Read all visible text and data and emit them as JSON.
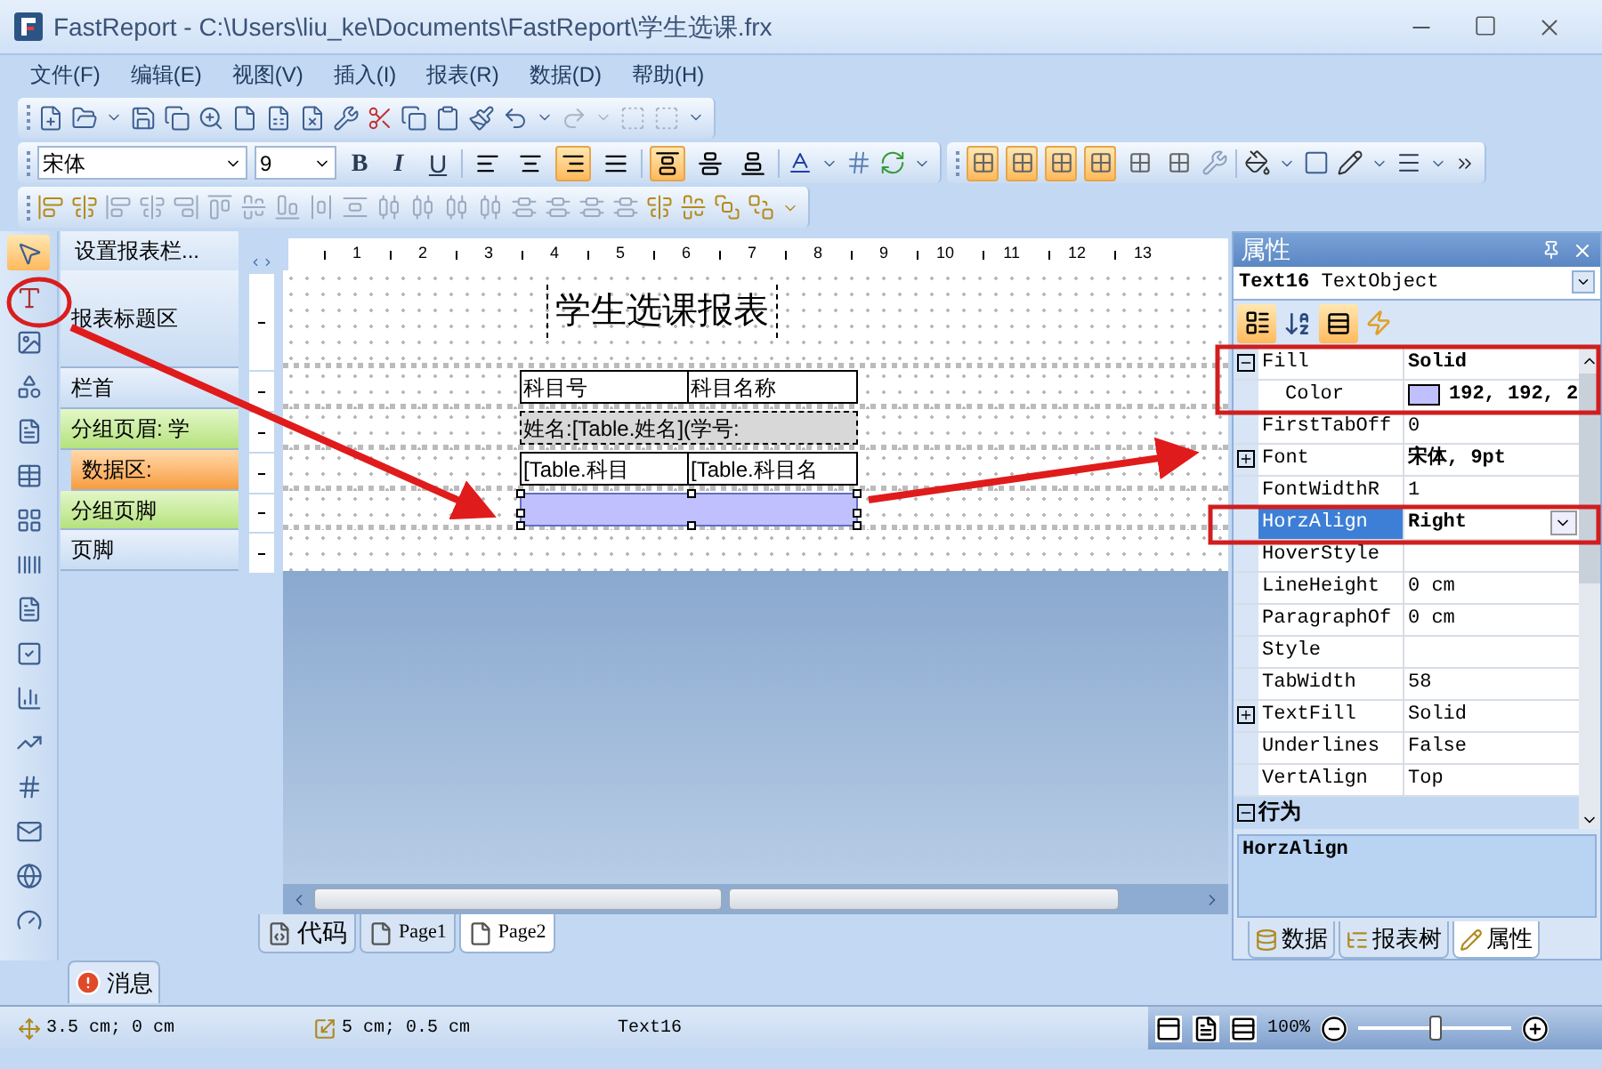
{
  "window": {
    "title": "FastReport - C:\\Users\\liu_ke\\Documents\\FastReport\\学生选课.frx"
  },
  "menu": [
    "文件(F)",
    "编辑(E)",
    "视图(V)",
    "插入(I)",
    "报表(R)",
    "数据(D)",
    "帮助(H)"
  ],
  "format_toolbar": {
    "font": "宋体",
    "size": "9",
    "styles": [
      {
        "label": "B",
        "kind": "bold"
      },
      {
        "label": "I",
        "kind": "italic"
      },
      {
        "label": "U",
        "kind": "underline"
      }
    ],
    "horz_align": [
      {
        "kind": "left",
        "selected": false
      },
      {
        "kind": "center",
        "selected": false
      },
      {
        "kind": "right",
        "selected": true
      },
      {
        "kind": "justify",
        "selected": false
      }
    ],
    "vert_align": [
      {
        "kind": "top",
        "selected": true
      },
      {
        "kind": "middle",
        "selected": false
      },
      {
        "kind": "bottom",
        "selected": false
      }
    ]
  },
  "border_toolbar": [
    {
      "selected": true
    },
    {
      "selected": true
    },
    {
      "selected": true
    },
    {
      "selected": true
    },
    {
      "selected": false
    },
    {
      "selected": false
    }
  ],
  "toolbox": [
    {
      "kind": "pointer",
      "selected": true
    },
    {
      "kind": "text",
      "selected": false
    },
    {
      "kind": "picture",
      "selected": false
    },
    {
      "kind": "shapes",
      "selected": false
    },
    {
      "kind": "subreport",
      "selected": false
    },
    {
      "kind": "table",
      "selected": false
    },
    {
      "kind": "matrix",
      "selected": false
    },
    {
      "kind": "barcode",
      "selected": false
    },
    {
      "kind": "richtext",
      "selected": false
    },
    {
      "kind": "checkbox",
      "selected": false
    },
    {
      "kind": "chart",
      "selected": false
    },
    {
      "kind": "sparkline",
      "selected": false
    },
    {
      "kind": "number",
      "selected": false
    },
    {
      "kind": "zipcode",
      "selected": false
    },
    {
      "kind": "map",
      "selected": false
    },
    {
      "kind": "gauge",
      "selected": false
    }
  ],
  "bands_header": "设置报表栏...",
  "ruler": [
    "1",
    "2",
    "3",
    "4",
    "5",
    "6",
    "7",
    "8",
    "9",
    "10",
    "11",
    "12",
    "13"
  ],
  "bands": [
    {
      "label": "报表标题区",
      "kind": "plain"
    },
    {
      "label": "栏首",
      "kind": "plain"
    },
    {
      "label": "分组页眉: 学",
      "kind": "group"
    },
    {
      "label": "数据区:",
      "kind": "data"
    },
    {
      "label": "分组页脚",
      "kind": "group"
    },
    {
      "label": "页脚",
      "kind": "plain"
    }
  ],
  "report": {
    "title": "学生选课报表",
    "header_cells": [
      "科目号",
      "科目名称"
    ],
    "group_text": "姓名:[Table.姓名](学号:",
    "data_cells": [
      "[Table.科目",
      "[Table.科目名"
    ]
  },
  "page_tabs": [
    {
      "label": "代码",
      "kind": "code",
      "selected": false
    },
    {
      "label": "Page1",
      "kind": "page",
      "selected": false
    },
    {
      "label": "Page2",
      "kind": "page",
      "selected": true
    }
  ],
  "message_tab": "消息",
  "properties": {
    "title": "属性",
    "object": "Text16",
    "object_type": "TextObject",
    "rows": [
      {
        "name": "Fill",
        "value": "Solid",
        "expanded": true,
        "modified": true,
        "selected": false
      },
      {
        "name": "Color",
        "value": "192, 192, 2",
        "color": "#c0c0ff",
        "child": true,
        "modified": true,
        "selected": false
      },
      {
        "name": "FirstTabOff",
        "value": "0",
        "modified": false,
        "selected": false
      },
      {
        "name": "Font",
        "value": "宋体, 9pt",
        "expanded": false,
        "modified": true,
        "selected": false
      },
      {
        "name": "FontWidthR",
        "value": "1",
        "modified": false,
        "selected": false
      },
      {
        "name": "HorzAlign",
        "value": "Right",
        "modified": true,
        "selected": true
      },
      {
        "name": "HoverStyle",
        "modified": false,
        "selected": false
      },
      {
        "name": "LineHeight",
        "value": "0 cm",
        "modified": false,
        "selected": false
      },
      {
        "name": "ParagraphOf",
        "value": "0 cm",
        "modified": false,
        "selected": false
      },
      {
        "name": "Style",
        "modified": false,
        "selected": false
      },
      {
        "name": "TabWidth",
        "value": "58",
        "modified": false,
        "selected": false
      },
      {
        "name": "TextFill",
        "value": "Solid",
        "expanded": false,
        "modified": false,
        "selected": false
      },
      {
        "name": "Underlines",
        "value": "False",
        "modified": false,
        "selected": false
      },
      {
        "name": "VertAlign",
        "value": "Top",
        "modified": false,
        "selected": false
      }
    ],
    "category": "行为",
    "description": "HorzAlign",
    "tabs": [
      {
        "label": "数据",
        "kind": "data",
        "selected": false
      },
      {
        "label": "报表树",
        "kind": "tree",
        "selected": false
      },
      {
        "label": "属性",
        "kind": "props",
        "selected": true
      }
    ]
  },
  "status": {
    "position": "3.5 cm; 0 cm",
    "size": "5 cm; 0.5 cm",
    "object": "Text16",
    "zoom": "100%",
    "zoom_level": {
      "level": 0.5
    }
  }
}
